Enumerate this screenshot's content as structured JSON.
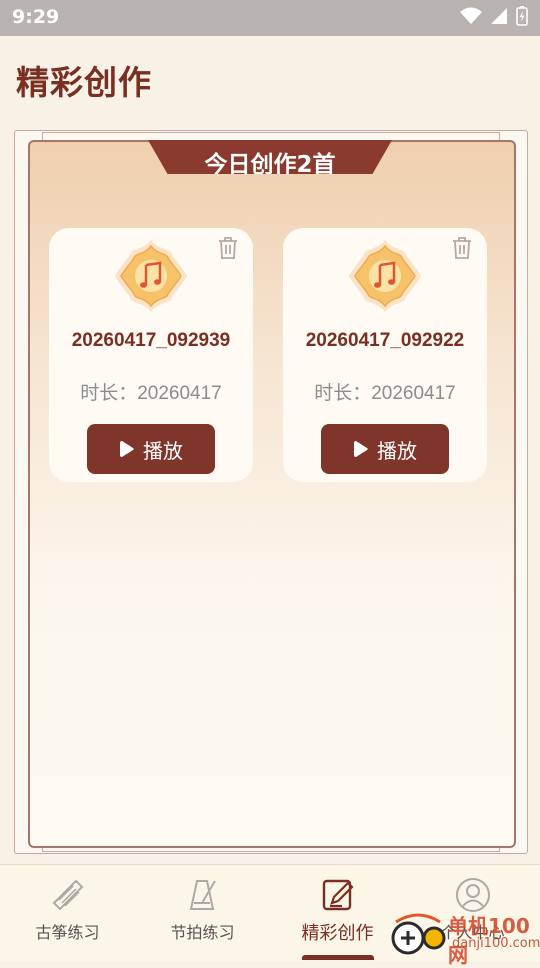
{
  "status": {
    "time": "9:29"
  },
  "header": {
    "title": "精彩创作"
  },
  "panel": {
    "ribbon": "今日创作2首"
  },
  "cards": [
    {
      "title": "20260417_092939",
      "duration": "时长：20260417",
      "play_label": "播放"
    },
    {
      "title": "20260417_092922",
      "duration": "时长：20260417",
      "play_label": "播放"
    }
  ],
  "nav": {
    "items": [
      {
        "label": "古筝练习",
        "icon": "zither-icon"
      },
      {
        "label": "节拍练习",
        "icon": "metronome-icon"
      },
      {
        "label": "精彩创作",
        "icon": "pen-note-icon",
        "active": true
      },
      {
        "label": "个人中心",
        "icon": "profile-icon"
      }
    ]
  },
  "watermark": {
    "site_cn": "单机100网",
    "site_url": "danji100.com"
  },
  "colors": {
    "accent": "#7a2f22",
    "button": "#7f3529",
    "badge": "#f7c36a"
  }
}
